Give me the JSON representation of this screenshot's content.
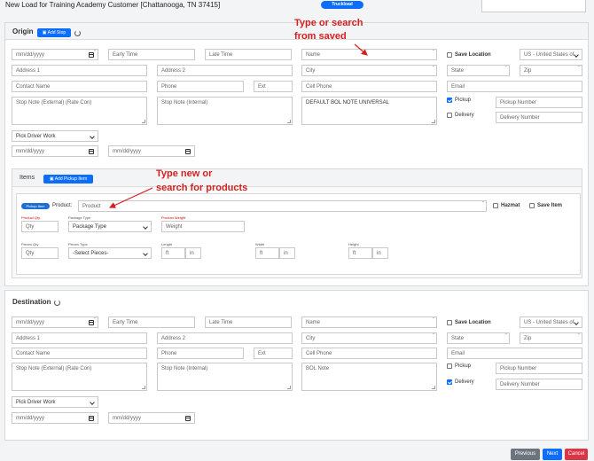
{
  "page": {
    "title": "New Load for Training Academy Customer [Chattanooga, TN 37415]",
    "mode_badge": "Truckload"
  },
  "annotations": {
    "origin_name_1": "Type or search",
    "origin_name_2": "from saved",
    "items_1": "Type new or",
    "items_2": "search for products"
  },
  "origin": {
    "title": "Origin",
    "add_stop": "Add Stop",
    "date_placeholder": "mm/dd/yyyy",
    "early_time": "Early Time",
    "late_time": "Late Time",
    "name": "Name",
    "save_location": "Save Location",
    "country": "US - United States of",
    "address1": "Address 1",
    "address2": "Address 2",
    "city": "City",
    "state": "State",
    "zip": "Zip",
    "contact_name": "Contact Name",
    "phone": "Phone",
    "ext": "Ext",
    "cell_phone": "Cell Phone",
    "email": "Email",
    "stop_note_external": "Stop Note (External) (Rate Con)",
    "stop_note_internal": "Stop Note (Internal)",
    "bol_note_value": "DEFAULT BOL NOTE UNIVERSAL",
    "pickup_label": "Pickup",
    "pickup_checked": true,
    "pickup_number": "Pickup Number",
    "delivery_label": "Delivery",
    "delivery_checked": false,
    "delivery_number": "Delivery Number",
    "driver_work": "Pick Driver Work",
    "date2a": "mm/dd/yyyy",
    "date2b": "mm/dd/yyyy"
  },
  "items": {
    "title": "Items",
    "add_pickup_item": "Add Pickup Item",
    "pickup_badge": "Pickup Item",
    "product_label": "Product:",
    "product_placeholder": "Product",
    "hazmat": "Hazmat",
    "save_item": "Save Item",
    "product_qty_label": "Product Qty",
    "product_qty": "Qty",
    "package_type_label": "Package Type",
    "package_type": "Package Type",
    "product_weight_label": "Product Weight",
    "weight": "Weight",
    "pieces_qty_label": "Pieces Qty",
    "pieces_qty": "Qty",
    "pieces_type_label": "Pieces Type",
    "pieces_type": "-Select Pieces-",
    "length_label": "Length",
    "width_label": "Width",
    "height_label": "Height",
    "ft": "ft",
    "in": "in"
  },
  "destination": {
    "title": "Destination",
    "date_placeholder": "mm/dd/yyyy",
    "early_time": "Early Time",
    "late_time": "Late Time",
    "name": "Name",
    "save_location": "Save Location",
    "country": "US - United States of",
    "address1": "Address 1",
    "address2": "Address 2",
    "city": "City",
    "state": "State",
    "zip": "Zip",
    "contact_name": "Contact Name",
    "phone": "Phone",
    "ext": "Ext",
    "cell_phone": "Cell Phone",
    "email": "Email",
    "stop_note_external": "Stop Note (External) (Rate Con)",
    "stop_note_internal": "Stop Note (Internal)",
    "bol_note": "BOL Note",
    "pickup_label": "Pickup",
    "pickup_checked": false,
    "pickup_number": "Pickup Number",
    "delivery_label": "Delivery",
    "delivery_checked": true,
    "delivery_number": "Delivery Number",
    "driver_work": "Pick Driver Work",
    "date2a": "mm/dd/yyyy",
    "date2b": "mm/dd/yyyy"
  },
  "footer": {
    "previous": "Previous",
    "next": "Next",
    "cancel": "Cancel"
  },
  "colors": {
    "primary": "#0d6efd",
    "annotation": "#d62020",
    "required": "#dd0000",
    "cancel": "#dc3545",
    "previous": "#6c757d"
  }
}
